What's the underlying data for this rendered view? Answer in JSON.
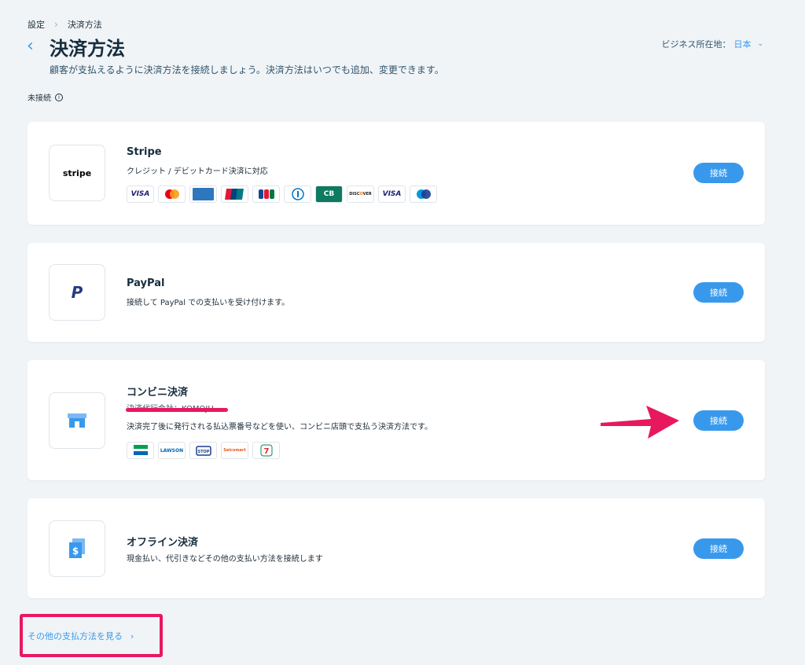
{
  "breadcrumb": {
    "parent": "設定",
    "current": "決済方法"
  },
  "header": {
    "title": "決済方法",
    "subtitle": "顧客が支払えるように決済方法を接続しましょう。決済方法はいつでも追加、変更できます。",
    "location_label": "ビジネス所在地：",
    "location_value": "日本"
  },
  "section": {
    "label": "未接続"
  },
  "providers": [
    {
      "name": "Stripe",
      "logo_text": "stripe",
      "description": "クレジット / デビットカード決済に対応",
      "button": "接続",
      "badges": [
        "VISA",
        "Mastercard",
        "American Express",
        "UnionPay",
        "JCB",
        "Diners Club",
        "CB",
        "DISCOVER",
        "VISA Electron",
        "Maestro"
      ]
    },
    {
      "name": "PayPal",
      "logo_text": "P",
      "description": "接続して PayPal での支払いを受け付けます。",
      "button": "接続"
    },
    {
      "name": "コンビニ決済",
      "agent": "決済代行会社：KOMOJU",
      "description": "決済完了後に発行される払込票番号などを使い、コンビニ店頭で支払う決済方法です。",
      "button": "接続",
      "badges": [
        "FamilyMart",
        "LAWSON",
        "MINI STOP",
        "Seicomart",
        "7-Eleven"
      ]
    },
    {
      "name": "オフライン決済",
      "description": "現金払い、代引きなどその他の支払い方法を接続します",
      "button": "接続"
    }
  ],
  "more_link": "その他の支払方法を見る",
  "colors": {
    "accent": "#3899ec",
    "annotation": "#e8185f",
    "background": "#f0f4f7"
  }
}
